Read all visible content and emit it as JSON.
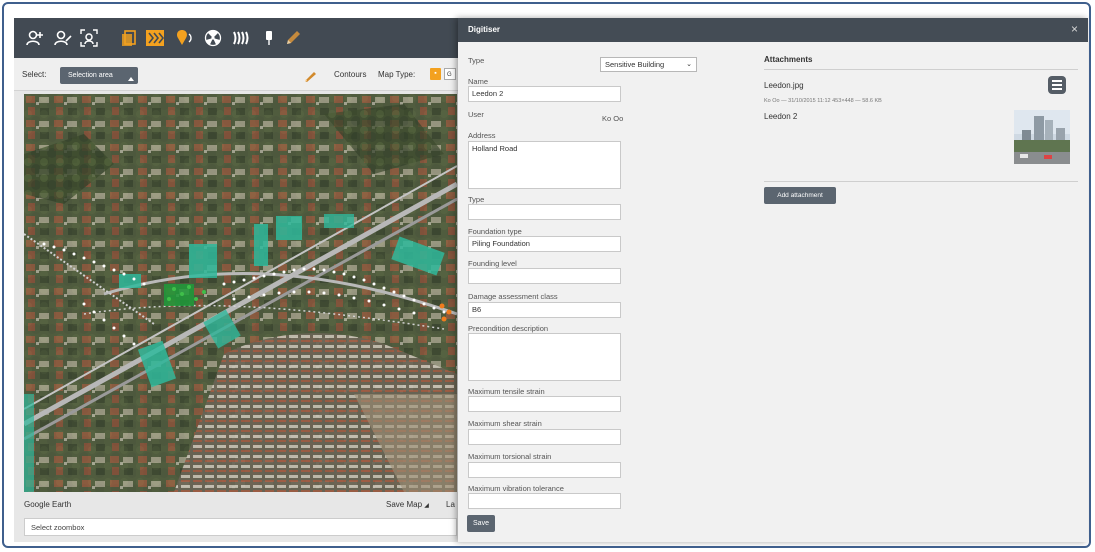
{
  "toolbar": {
    "icons": [
      "add-user-icon",
      "user-edit-icon",
      "user-search-icon",
      "layers-icon",
      "chevrons-icon",
      "marker-icon",
      "radiation-icon",
      "vibration-icon",
      "pin-icon",
      "pencil-icon"
    ],
    "colors": {
      "bar": "#424a53",
      "white_icon": "#ffffff",
      "orange_icon": "#f3a11f"
    }
  },
  "subbar": {
    "select_label": "Select:",
    "select_button": "Selection area",
    "contours_label": "Contours",
    "map_type_label": "Map Type:"
  },
  "footer": {
    "map_source": "Google Earth",
    "save_map": "Save Map",
    "truncated_label": "La",
    "zoombox_value": "Select zoombox"
  },
  "dialog": {
    "title": "Digitiser",
    "close_symbol": "×",
    "form": {
      "type_label": "Type",
      "type_value": "Sensitive Building",
      "name_label": "Name",
      "name_value": "Leedon 2",
      "user_label": "User",
      "user_value": "Ko Oo",
      "address_label": "Address",
      "address_value": "Holland Road",
      "type2_label": "Type",
      "type2_value": "",
      "foundation_type_label": "Foundation type",
      "foundation_type_value": "Piling Foundation",
      "founding_level_label": "Founding level",
      "founding_level_value": "",
      "damage_class_label": "Damage assessment class",
      "damage_class_value": "B6",
      "precondition_label": "Precondition description",
      "precondition_value": "",
      "tensile_label": "Maximum tensile strain",
      "tensile_value": "",
      "shear_label": "Maximum shear strain",
      "shear_value": "",
      "torsional_label": "Maximum torsional strain",
      "torsional_value": "",
      "vibration_label": "Maximum vibration tolerance",
      "vibration_value": "",
      "save_button": "Save"
    },
    "attachments": {
      "title": "Attachments",
      "file_name": "Leedon.jpg",
      "file_meta": "Ko Oo — 31/10/2015 11:12     453×448 — 58.6 KB",
      "caption": "Leedon 2",
      "add_button": "Add attachment"
    }
  }
}
